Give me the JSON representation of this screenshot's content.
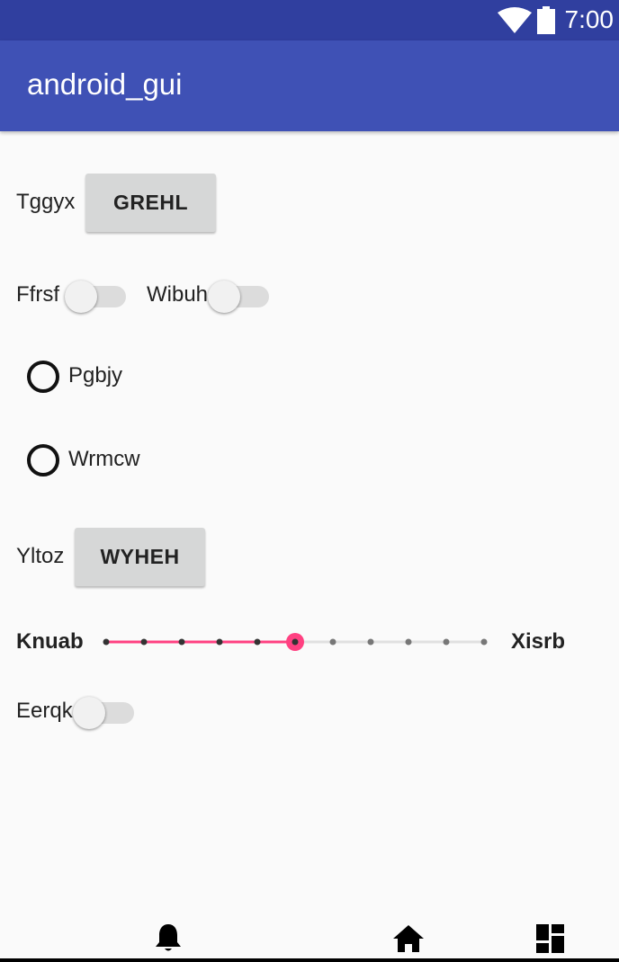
{
  "status_bar": {
    "time": "7:00",
    "icons": [
      "wifi-icon",
      "battery-icon"
    ]
  },
  "app_bar": {
    "title": "android_gui"
  },
  "rows": {
    "tggyx": {
      "label": "Tggyx",
      "button": "GREHL"
    },
    "ffrsf": {
      "label": "Ffrsf",
      "checked": false
    },
    "wibuh": {
      "label": "Wibuh",
      "checked": false
    },
    "radio1": {
      "label": "Pgbjy",
      "checked": false
    },
    "radio2": {
      "label": "Wrmcw",
      "checked": false
    },
    "yltoz": {
      "label": "Yltoz",
      "button": "WYHEH"
    },
    "slider": {
      "left_label": "Knuab",
      "right_label": "Xisrb",
      "min": 0,
      "max": 10,
      "value": 5
    },
    "eerqk": {
      "label": "Eerqk",
      "checked": false
    }
  },
  "nav_bar": {
    "icons": [
      "bell-icon",
      "home-icon",
      "dashboard-icon"
    ]
  },
  "colors": {
    "primary": "#3f51b5",
    "primary_dark": "#303f9f",
    "accent": "#ff4081"
  }
}
